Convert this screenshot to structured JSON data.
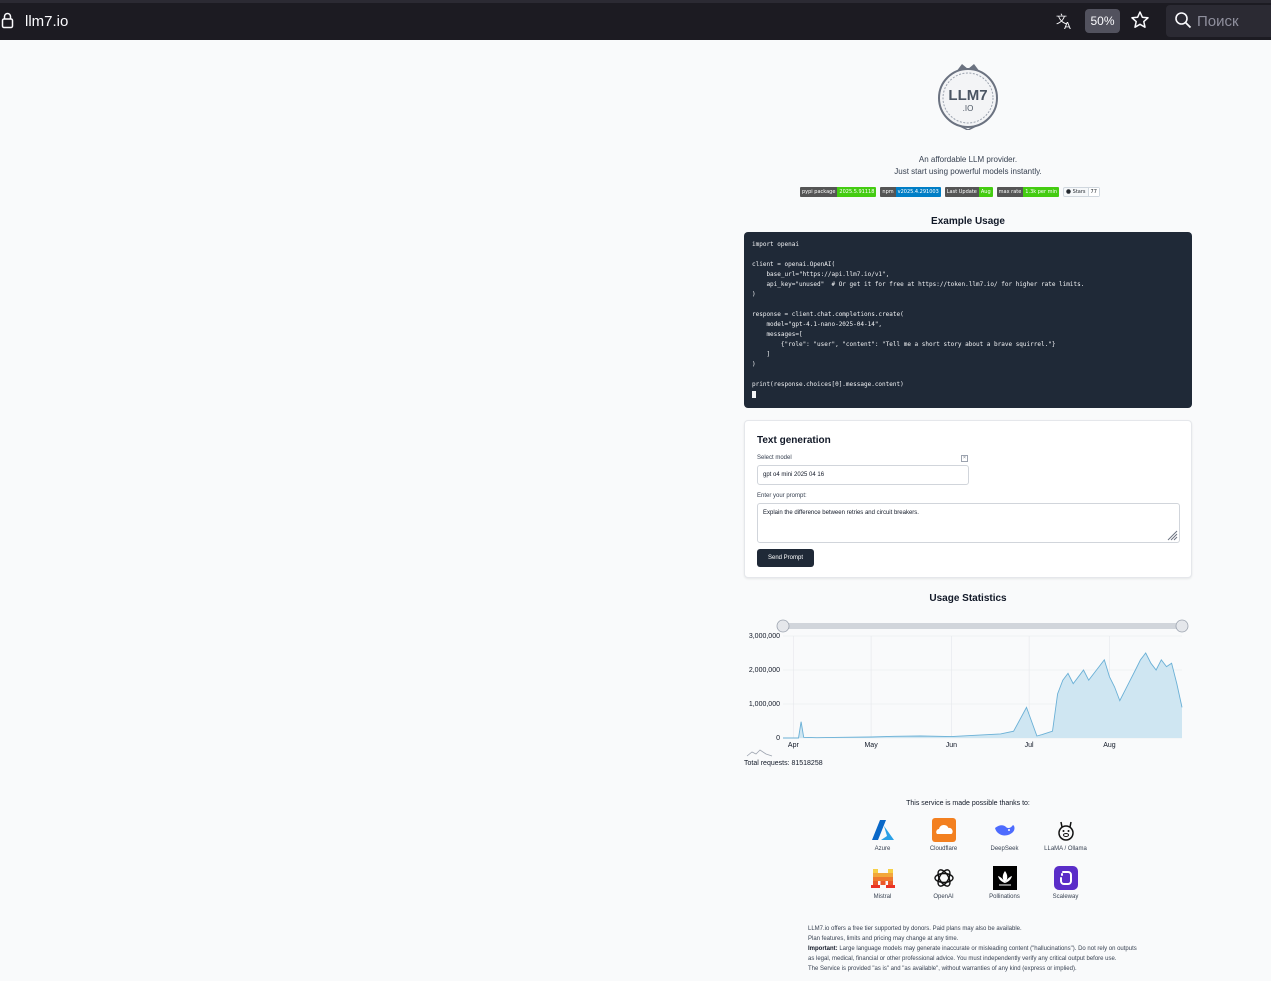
{
  "browser": {
    "url": "llm7.io",
    "zoom": "50%",
    "search_placeholder": "Поиск"
  },
  "header": {
    "logo_text": "LLM7",
    "logo_sub": ".IO",
    "tagline_1": "An affordable LLM provider.",
    "tagline_2": "Just start using powerful models instantly."
  },
  "badges": [
    {
      "label": "pypi package",
      "value": "2025.5.91118",
      "color": "#44cc11"
    },
    {
      "label": "npm",
      "value": "v2025.4.291003",
      "color": "#007ec6"
    },
    {
      "label": "Last Update",
      "value": "Aug",
      "color": "#44cc11"
    },
    {
      "label": "max rate",
      "value": "1.3k per min",
      "color": "#44cc11"
    }
  ],
  "github": {
    "label": "Stars",
    "count": "77"
  },
  "example": {
    "heading": "Example Usage",
    "code": "import openai\n\nclient = openai.OpenAI(\n    base_url=\"https://api.llm7.io/v1\",\n    api_key=\"unused\"  # Or get it for free at https://token.llm7.io/ for higher rate limits.\n)\n\nresponse = client.chat.completions.create(\n    model=\"gpt-4.1-nano-2025-04-14\",\n    messages=[\n        {\"role\": \"user\", \"content\": \"Tell me a short story about a brave squirrel.\"}\n    ]\n)\n\nprint(response.choices[0].message.content)\n"
  },
  "textgen": {
    "title": "Text generation",
    "select_label": "Select model",
    "model_value": "gpt o4 mini 2025 04 16",
    "prompt_label": "Enter your prompt:",
    "prompt_value": "Explain the difference between retries and circuit breakers.",
    "button": "Send Prompt"
  },
  "usage": {
    "heading": "Usage Statistics",
    "total_label": "Total requests: 81518258"
  },
  "chart_data": {
    "type": "area",
    "title": "Usage Statistics",
    "xlabel": "",
    "ylabel": "",
    "ylim": [
      0,
      3000000
    ],
    "yticks": [
      "0",
      "1,000,000",
      "2,000,000",
      "3,000,000"
    ],
    "xticks": [
      "Apr",
      "May",
      "Jun",
      "Jul",
      "Aug"
    ],
    "grid": true,
    "series": [
      {
        "color": "#6ab0d6",
        "fill": "#cfe6f2",
        "x": [
          "2025-03-28",
          "2025-04-03",
          "2025-04-04",
          "2025-04-05",
          "2025-04-10",
          "2025-04-20",
          "2025-05-01",
          "2025-05-10",
          "2025-05-20",
          "2025-06-01",
          "2025-06-10",
          "2025-06-20",
          "2025-06-25",
          "2025-06-30",
          "2025-07-04",
          "2025-07-06",
          "2025-07-10",
          "2025-07-12",
          "2025-07-14",
          "2025-07-16",
          "2025-07-18",
          "2025-07-20",
          "2025-07-22",
          "2025-07-24",
          "2025-07-26",
          "2025-07-28",
          "2025-07-30",
          "2025-08-01",
          "2025-08-03",
          "2025-08-05",
          "2025-08-07",
          "2025-08-09",
          "2025-08-11",
          "2025-08-13",
          "2025-08-15",
          "2025-08-17",
          "2025-08-19",
          "2025-08-21",
          "2025-08-23",
          "2025-08-25",
          "2025-08-27",
          "2025-08-29"
        ],
        "y": [
          0,
          0,
          480000,
          20000,
          10000,
          20000,
          30000,
          50000,
          60000,
          40000,
          80000,
          120000,
          200000,
          900000,
          60000,
          100000,
          200000,
          1300000,
          1700000,
          1900000,
          1600000,
          1800000,
          2000000,
          1700000,
          1900000,
          2100000,
          2300000,
          1800000,
          1500000,
          1100000,
          1400000,
          1700000,
          2000000,
          2300000,
          2500000,
          2200000,
          2000000,
          2300000,
          2100000,
          2200000,
          1600000,
          900000
        ]
      }
    ]
  },
  "sponsors": {
    "heading": "This service is made possible thanks to:",
    "items": [
      {
        "name": "Azure",
        "icon": "azure-icon"
      },
      {
        "name": "Cloudflare",
        "icon": "cloudflare-icon"
      },
      {
        "name": "DeepSeek",
        "icon": "deepseek-icon"
      },
      {
        "name": "LLaMA / Ollama",
        "icon": "ollama-icon"
      },
      {
        "name": "Mistral",
        "icon": "mistral-icon"
      },
      {
        "name": "OpenAI",
        "icon": "openai-icon"
      },
      {
        "name": "Pollinations",
        "icon": "pollinations-icon"
      },
      {
        "name": "Scaleway",
        "icon": "scaleway-icon"
      }
    ]
  },
  "footer": {
    "line1": "LLM7.io offers a free tier supported by donors. Paid plans may also be available.",
    "line2": "Plan features, limits and pricing may change at any time.",
    "important": "Important:",
    "line3": "Large language models may generate inaccurate or misleading content (\"hallucinations\"). Do not rely on outputs as legal, medical, financial or other professional advice. You must independently verify any critical output before use.",
    "line4": "The Service is provided \"as is\" and \"as available\", without warranties of any kind (express or implied)."
  }
}
